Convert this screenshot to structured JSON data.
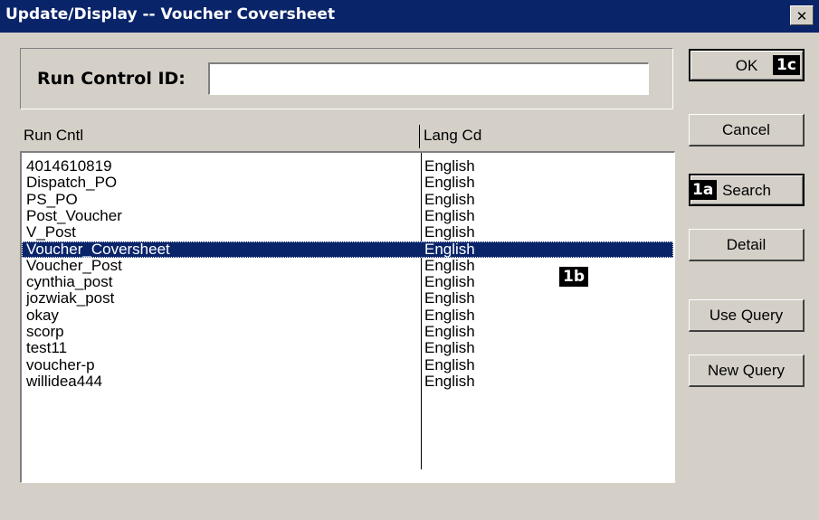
{
  "window": {
    "title": "Update/Display -- Voucher Coversheet",
    "close_glyph": "✕"
  },
  "run_control": {
    "label": "Run Control ID:",
    "value": ""
  },
  "list": {
    "headers": [
      "Run Cntl",
      "Lang Cd"
    ],
    "rows": [
      {
        "run_cntl": "4014610819",
        "lang_cd": "English"
      },
      {
        "run_cntl": "Dispatch_PO",
        "lang_cd": "English"
      },
      {
        "run_cntl": "PS_PO",
        "lang_cd": "English"
      },
      {
        "run_cntl": "Post_Voucher",
        "lang_cd": "English"
      },
      {
        "run_cntl": "V_Post",
        "lang_cd": "English"
      },
      {
        "run_cntl": "Voucher_Coversheet",
        "lang_cd": "English"
      },
      {
        "run_cntl": "Voucher_Post",
        "lang_cd": "English"
      },
      {
        "run_cntl": "cynthia_post",
        "lang_cd": "English"
      },
      {
        "run_cntl": "jozwiak_post",
        "lang_cd": "English"
      },
      {
        "run_cntl": "okay",
        "lang_cd": "English"
      },
      {
        "run_cntl": "scorp",
        "lang_cd": "English"
      },
      {
        "run_cntl": "test11",
        "lang_cd": "English"
      },
      {
        "run_cntl": "voucher-p",
        "lang_cd": "English"
      },
      {
        "run_cntl": "willidea444",
        "lang_cd": "English"
      }
    ],
    "selected_index": 5
  },
  "buttons": {
    "ok": "OK",
    "cancel": "Cancel",
    "search": "Search",
    "detail": "Detail",
    "use_query": "Use Query",
    "new_query": "New Query"
  },
  "callouts": {
    "search": "1a",
    "selected_row": "1b",
    "ok": "1c"
  },
  "colors": {
    "title_bar": "#0a246a",
    "dialog_bg": "#d4d0c8",
    "selection": "#0a246a"
  }
}
